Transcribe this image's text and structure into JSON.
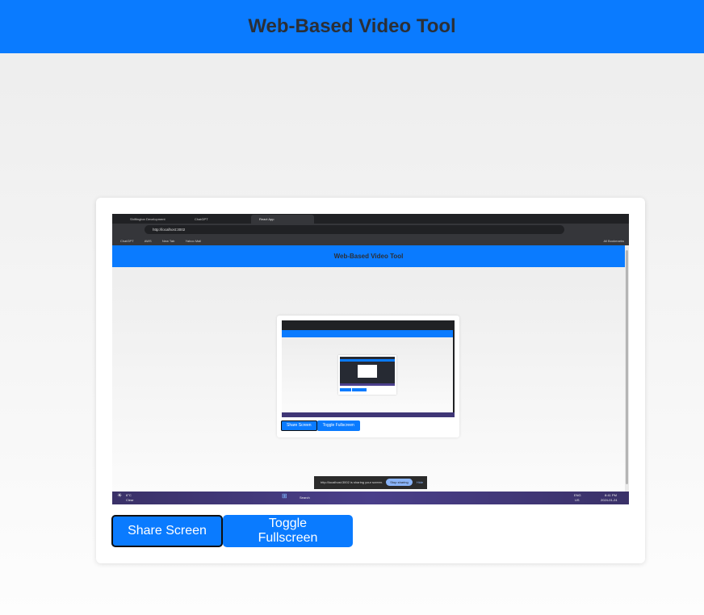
{
  "header": {
    "title": "Web-Based Video Tool"
  },
  "preview": {
    "browser_tabs": [
      "Shiftington Development",
      "ChatGPT",
      "React App"
    ],
    "url": "http://localhost:3002",
    "bookmarks": [
      "ChatGPT",
      "AWS",
      "New Tab",
      "Yahoo Mail",
      "All Bookmarks"
    ],
    "page_title": "Web-Based Video Tool",
    "inner_buttons": [
      "Share Screen",
      "Toggle Fullscreen"
    ],
    "share_bar": {
      "text": "http://localhost:3002 is sharing your screen.",
      "stop": "Stop sharing",
      "hide": "Hide"
    },
    "taskbar": {
      "weather": "6°C",
      "weather_sub": "Clear",
      "search": "Search",
      "lang": "ENG",
      "lang_sub": "US",
      "time": "8:41 PM",
      "date": "2024-01-24"
    }
  },
  "controls": {
    "share_label": "Share Screen",
    "fullscreen_label": "Toggle Fullscreen"
  },
  "colors": {
    "accent": "#0a7bff",
    "title_text": "#2b2f36"
  }
}
